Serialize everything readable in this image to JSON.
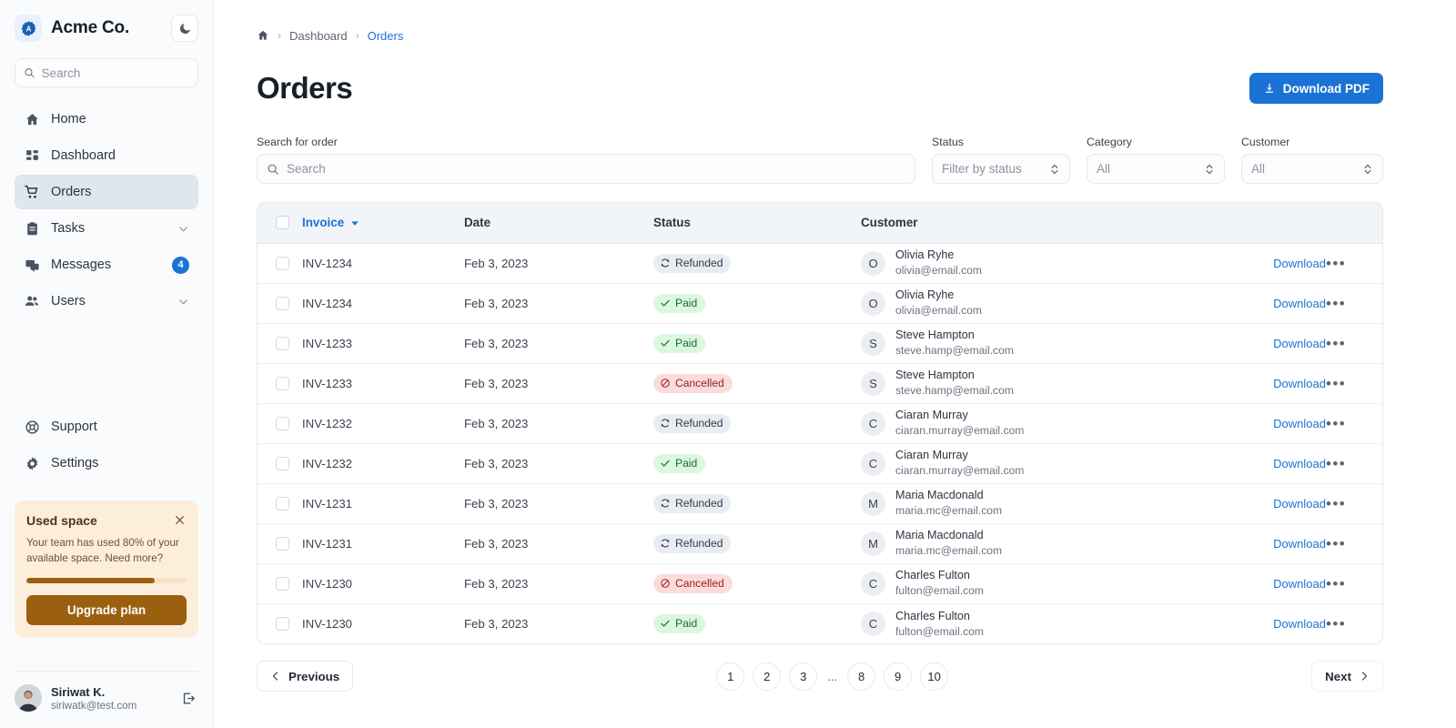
{
  "sidebar": {
    "brand": {
      "name": "Acme Co.",
      "logo_letter": "A"
    },
    "theme_toggle": "moon-icon",
    "search": {
      "placeholder": "Search",
      "value": ""
    },
    "nav": [
      {
        "label": "Home",
        "icon": "home-icon",
        "active": false
      },
      {
        "label": "Dashboard",
        "icon": "dashboard-icon",
        "active": false
      },
      {
        "label": "Orders",
        "icon": "cart-icon",
        "active": true
      },
      {
        "label": "Tasks",
        "icon": "clipboard-icon",
        "active": false,
        "chevron": true
      },
      {
        "label": "Messages",
        "icon": "messages-icon",
        "active": false,
        "badge": "4"
      },
      {
        "label": "Users",
        "icon": "users-icon",
        "active": false,
        "chevron": true
      }
    ],
    "footer_nav": [
      {
        "label": "Support",
        "icon": "lifebuoy-icon"
      },
      {
        "label": "Settings",
        "icon": "gear-icon"
      }
    ],
    "promo": {
      "title": "Used space",
      "text": "Your team has used 80% of your available space. Need more?",
      "progress_percent": 80,
      "button": "Upgrade plan",
      "close": "close-icon"
    },
    "user": {
      "name": "Siriwat K.",
      "email": "siriwatk@test.com",
      "logout": "logout-icon"
    }
  },
  "header": {
    "breadcrumb": [
      {
        "label": "",
        "icon": "home-icon"
      },
      {
        "label": "Dashboard"
      },
      {
        "label": "Orders",
        "current": true
      }
    ],
    "separator": "›",
    "title": "Orders",
    "download_pdf": "Download PDF"
  },
  "filters": {
    "search": {
      "label": "Search for order",
      "placeholder": "Search",
      "value": ""
    },
    "status": {
      "label": "Status",
      "value": "Filter by status"
    },
    "category": {
      "label": "Category",
      "value": "All"
    },
    "customer": {
      "label": "Customer",
      "value": "All"
    }
  },
  "table": {
    "columns": [
      "Invoice",
      "Date",
      "Status",
      "Customer",
      "",
      ""
    ],
    "sorted_column": "Invoice",
    "sort_direction": "desc",
    "rows": [
      {
        "invoice": "INV-1234",
        "date": "Feb 3, 2023",
        "status": "Refunded",
        "status_kind": "refunded",
        "initial": "O",
        "name": "Olivia Ryhe",
        "email": "olivia@email.com",
        "action": "Download"
      },
      {
        "invoice": "INV-1234",
        "date": "Feb 3, 2023",
        "status": "Paid",
        "status_kind": "paid",
        "initial": "O",
        "name": "Olivia Ryhe",
        "email": "olivia@email.com",
        "action": "Download"
      },
      {
        "invoice": "INV-1233",
        "date": "Feb 3, 2023",
        "status": "Paid",
        "status_kind": "paid",
        "initial": "S",
        "name": "Steve Hampton",
        "email": "steve.hamp@email.com",
        "action": "Download"
      },
      {
        "invoice": "INV-1233",
        "date": "Feb 3, 2023",
        "status": "Cancelled",
        "status_kind": "cancelled",
        "initial": "S",
        "name": "Steve Hampton",
        "email": "steve.hamp@email.com",
        "action": "Download"
      },
      {
        "invoice": "INV-1232",
        "date": "Feb 3, 2023",
        "status": "Refunded",
        "status_kind": "refunded",
        "initial": "C",
        "name": "Ciaran Murray",
        "email": "ciaran.murray@email.com",
        "action": "Download"
      },
      {
        "invoice": "INV-1232",
        "date": "Feb 3, 2023",
        "status": "Paid",
        "status_kind": "paid",
        "initial": "C",
        "name": "Ciaran Murray",
        "email": "ciaran.murray@email.com",
        "action": "Download"
      },
      {
        "invoice": "INV-1231",
        "date": "Feb 3, 2023",
        "status": "Refunded",
        "status_kind": "refunded",
        "initial": "M",
        "name": "Maria Macdonald",
        "email": "maria.mc@email.com",
        "action": "Download"
      },
      {
        "invoice": "INV-1231",
        "date": "Feb 3, 2023",
        "status": "Refunded",
        "status_kind": "refunded",
        "initial": "M",
        "name": "Maria Macdonald",
        "email": "maria.mc@email.com",
        "action": "Download"
      },
      {
        "invoice": "INV-1230",
        "date": "Feb 3, 2023",
        "status": "Cancelled",
        "status_kind": "cancelled",
        "initial": "C",
        "name": "Charles Fulton",
        "email": "fulton@email.com",
        "action": "Download"
      },
      {
        "invoice": "INV-1230",
        "date": "Feb 3, 2023",
        "status": "Paid",
        "status_kind": "paid",
        "initial": "C",
        "name": "Charles Fulton",
        "email": "fulton@email.com",
        "action": "Download"
      }
    ],
    "row_menu": "•••"
  },
  "pagination": {
    "previous": "Previous",
    "next": "Next",
    "pages": [
      "1",
      "2",
      "3",
      "...",
      "8",
      "9",
      "10"
    ],
    "current_page": "1"
  },
  "colors": {
    "accent": "#1a73d4",
    "paid": "#dcf7e0",
    "refunded": "#e9edf2",
    "cancelled": "#fbdcdc",
    "promo_bg": "#fdeedb",
    "promo_accent": "#9b5f10"
  }
}
